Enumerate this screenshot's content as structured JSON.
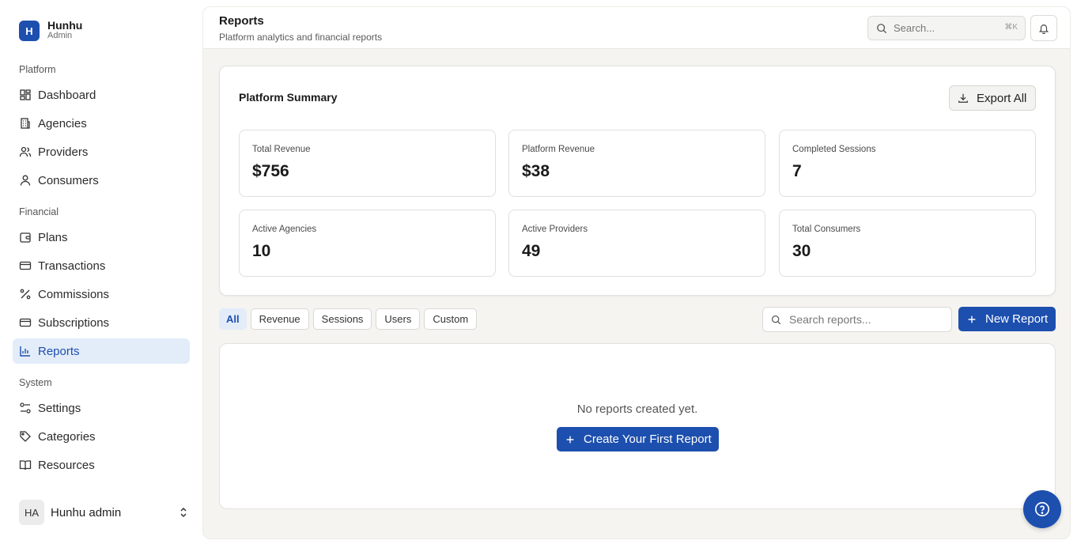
{
  "brand": {
    "initial": "H",
    "name": "Hunhu",
    "role": "Admin"
  },
  "sidebar": {
    "groups": [
      {
        "label": "Platform",
        "items": [
          "Dashboard",
          "Agencies",
          "Providers",
          "Consumers"
        ]
      },
      {
        "label": "Financial",
        "items": [
          "Plans",
          "Transactions",
          "Commissions",
          "Subscriptions",
          "Reports"
        ]
      },
      {
        "label": "System",
        "items": [
          "Settings",
          "Categories",
          "Resources"
        ]
      }
    ],
    "active_item": "Reports"
  },
  "user": {
    "initials": "HA",
    "name": "Hunhu admin"
  },
  "header": {
    "title": "Reports",
    "subtitle": "Platform analytics and financial reports",
    "search_placeholder": "Search...",
    "search_shortcut": "⌘K"
  },
  "summary": {
    "title": "Platform Summary",
    "export_label": "Export All",
    "stats": [
      {
        "label": "Total Revenue",
        "value": "$756"
      },
      {
        "label": "Platform Revenue",
        "value": "$38"
      },
      {
        "label": "Completed Sessions",
        "value": "7"
      },
      {
        "label": "Active Agencies",
        "value": "10"
      },
      {
        "label": "Active Providers",
        "value": "49"
      },
      {
        "label": "Total Consumers",
        "value": "30"
      }
    ]
  },
  "filters": {
    "tabs": [
      "All",
      "Revenue",
      "Sessions",
      "Users",
      "Custom"
    ],
    "active": "All"
  },
  "reports": {
    "search_placeholder": "Search reports...",
    "new_report_label": "New Report",
    "empty_text": "No reports created yet.",
    "create_first_label": "Create Your First Report"
  },
  "colors": {
    "accent": "#1d4fae",
    "active_bg": "#e3ecf9",
    "main_bg": "#f5f4f1"
  }
}
